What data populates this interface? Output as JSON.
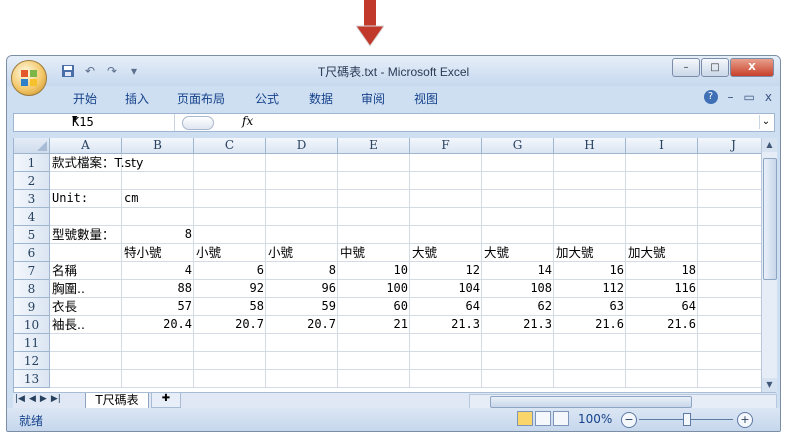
{
  "window": {
    "title": "T尺碼表.txt - Microsoft Excel",
    "controls": {
      "minimize": "–",
      "maximize": "□",
      "close": "X"
    }
  },
  "quick_access": {
    "undo": "↶",
    "redo": "↷",
    "customize": "▾"
  },
  "ribbon": {
    "tabs": [
      "开始",
      "插入",
      "页面布局",
      "公式",
      "数据",
      "审阅",
      "视图"
    ],
    "help": "?",
    "min": "–",
    "restore": "▭",
    "close": "x"
  },
  "formula_bar": {
    "name_box": "K15",
    "fx": "fx",
    "formula": ""
  },
  "columns": [
    "A",
    "B",
    "C",
    "D",
    "E",
    "F",
    "G",
    "H",
    "I",
    "J"
  ],
  "rows": [
    {
      "num": "1",
      "cells": [
        {
          "col": 0,
          "text": "款式檔案：T.sty",
          "cjk": true
        }
      ]
    },
    {
      "num": "2",
      "cells": []
    },
    {
      "num": "3",
      "cells": [
        {
          "col": 0,
          "text": "Unit:"
        },
        {
          "col": 1,
          "text": "cm"
        }
      ]
    },
    {
      "num": "4",
      "cells": []
    },
    {
      "num": "5",
      "cells": [
        {
          "col": 0,
          "text": "型號數量：",
          "cjk": true
        },
        {
          "col": 1,
          "text": "8",
          "num": true
        }
      ]
    },
    {
      "num": "6",
      "cells": [
        {
          "col": 1,
          "text": "特小號",
          "cjk": true
        },
        {
          "col": 2,
          "text": "小號",
          "cjk": true
        },
        {
          "col": 3,
          "text": "小號",
          "cjk": true
        },
        {
          "col": 4,
          "text": "中號",
          "cjk": true
        },
        {
          "col": 5,
          "text": "大號",
          "cjk": true
        },
        {
          "col": 6,
          "text": "大號",
          "cjk": true
        },
        {
          "col": 7,
          "text": "加大號",
          "cjk": true
        },
        {
          "col": 8,
          "text": "加大號",
          "cjk": true
        }
      ]
    },
    {
      "num": "7",
      "cells": [
        {
          "col": 0,
          "text": "名稱",
          "cjk": true
        },
        {
          "col": 1,
          "text": "4",
          "num": true
        },
        {
          "col": 2,
          "text": "6",
          "num": true
        },
        {
          "col": 3,
          "text": "8",
          "num": true
        },
        {
          "col": 4,
          "text": "10",
          "num": true
        },
        {
          "col": 5,
          "text": "12",
          "num": true
        },
        {
          "col": 6,
          "text": "14",
          "num": true
        },
        {
          "col": 7,
          "text": "16",
          "num": true
        },
        {
          "col": 8,
          "text": "18",
          "num": true
        }
      ]
    },
    {
      "num": "8",
      "cells": [
        {
          "col": 0,
          "text": "胸圍..",
          "cjk": true
        },
        {
          "col": 1,
          "text": "88",
          "num": true
        },
        {
          "col": 2,
          "text": "92",
          "num": true
        },
        {
          "col": 3,
          "text": "96",
          "num": true
        },
        {
          "col": 4,
          "text": "100",
          "num": true
        },
        {
          "col": 5,
          "text": "104",
          "num": true
        },
        {
          "col": 6,
          "text": "108",
          "num": true
        },
        {
          "col": 7,
          "text": "112",
          "num": true
        },
        {
          "col": 8,
          "text": "116",
          "num": true
        }
      ]
    },
    {
      "num": "9",
      "cells": [
        {
          "col": 0,
          "text": "衣長",
          "cjk": true
        },
        {
          "col": 1,
          "text": "57",
          "num": true
        },
        {
          "col": 2,
          "text": "58",
          "num": true
        },
        {
          "col": 3,
          "text": "59",
          "num": true
        },
        {
          "col": 4,
          "text": "60",
          "num": true
        },
        {
          "col": 5,
          "text": "64",
          "num": true
        },
        {
          "col": 6,
          "text": "62",
          "num": true
        },
        {
          "col": 7,
          "text": "63",
          "num": true
        },
        {
          "col": 8,
          "text": "64",
          "num": true
        }
      ]
    },
    {
      "num": "10",
      "cells": [
        {
          "col": 0,
          "text": "袖長..",
          "cjk": true
        },
        {
          "col": 1,
          "text": "20.4",
          "num": true
        },
        {
          "col": 2,
          "text": "20.7",
          "num": true
        },
        {
          "col": 3,
          "text": "20.7",
          "num": true
        },
        {
          "col": 4,
          "text": "21",
          "num": true
        },
        {
          "col": 5,
          "text": "21.3",
          "num": true
        },
        {
          "col": 6,
          "text": "21.3",
          "num": true
        },
        {
          "col": 7,
          "text": "21.6",
          "num": true
        },
        {
          "col": 8,
          "text": "21.6",
          "num": true
        }
      ]
    },
    {
      "num": "11",
      "cells": []
    },
    {
      "num": "12",
      "cells": []
    },
    {
      "num": "13",
      "cells": []
    }
  ],
  "sheet_tabs": {
    "active": "T尺碼表",
    "new_tab_icon": "insert-sheet-icon"
  },
  "status": {
    "ready": "就绪",
    "zoom": "100%",
    "zoom_out": "−",
    "zoom_in": "+"
  },
  "colors": {
    "accent": "#c0392b",
    "window_border": "#7c8ea6",
    "tab_text": "#15428b"
  }
}
